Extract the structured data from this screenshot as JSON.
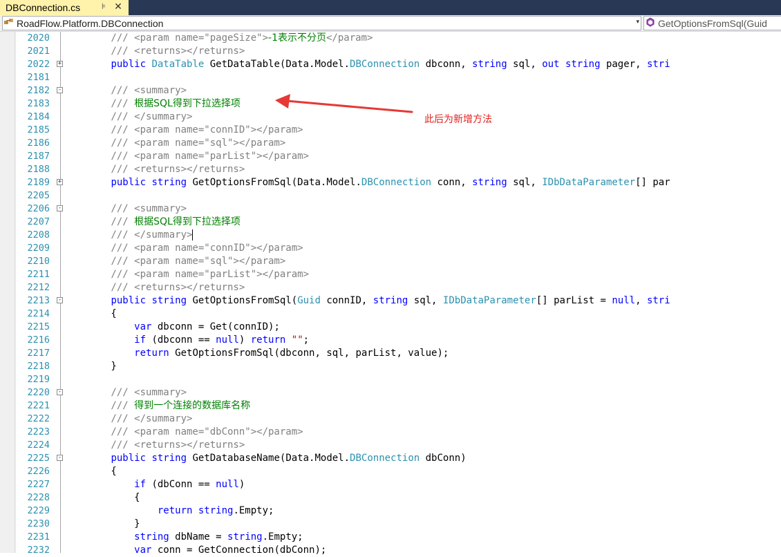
{
  "tab": {
    "title": "DBConnection.cs",
    "pin_glyph": "⊧",
    "close_glyph": "✕"
  },
  "navbar": {
    "left_path": "RoadFlow.Platform.DBConnection",
    "left_icon": "class-icon",
    "right_member": "GetOptionsFromSql(Guid",
    "right_icon": "method-icon",
    "dropdown_glyph": "▾"
  },
  "annotation": {
    "text": "此后为新增方法",
    "color": "#e0201e"
  },
  "colors": {
    "keyword": "#0000ff",
    "type": "#2b91af",
    "comment": "#808080",
    "xml_text": "#008000",
    "line_number": "#2b91af",
    "string": "#a31515"
  },
  "lines": [
    {
      "n": "2020",
      "fold": "",
      "tokens": [
        {
          "t": "        /// <param name=\"pageSize\">",
          "c": "cmt"
        },
        {
          "t": "-1表示不分页",
          "c": "green"
        },
        {
          "t": "</param>",
          "c": "cmt"
        }
      ]
    },
    {
      "n": "2021",
      "fold": "",
      "tokens": [
        {
          "t": "        /// <returns></returns>",
          "c": "cmt"
        }
      ]
    },
    {
      "n": "2022",
      "fold": "+",
      "tokens": [
        {
          "t": "        ",
          "c": ""
        },
        {
          "t": "public",
          "c": "kw"
        },
        {
          "t": " ",
          "c": ""
        },
        {
          "t": "DataTable",
          "c": "type"
        },
        {
          "t": " GetDataTable(Data.Model.",
          "c": ""
        },
        {
          "t": "DBConnection",
          "c": "type"
        },
        {
          "t": " dbconn, ",
          "c": ""
        },
        {
          "t": "string",
          "c": "kw"
        },
        {
          "t": " sql, ",
          "c": ""
        },
        {
          "t": "out",
          "c": "kw"
        },
        {
          "t": " ",
          "c": ""
        },
        {
          "t": "string",
          "c": "kw"
        },
        {
          "t": " pager, ",
          "c": ""
        },
        {
          "t": "stri",
          "c": "kw"
        }
      ]
    },
    {
      "n": "2181",
      "fold": "",
      "tokens": []
    },
    {
      "n": "2182",
      "fold": "-",
      "tokens": [
        {
          "t": "        /// <summary>",
          "c": "cmt"
        }
      ]
    },
    {
      "n": "2183",
      "fold": "",
      "tokens": [
        {
          "t": "        /// ",
          "c": "cmt"
        },
        {
          "t": "根据SQL得到下拉选择项",
          "c": "green"
        }
      ]
    },
    {
      "n": "2184",
      "fold": "",
      "tokens": [
        {
          "t": "        /// </summary>",
          "c": "cmt"
        }
      ]
    },
    {
      "n": "2185",
      "fold": "",
      "tokens": [
        {
          "t": "        /// <param name=\"connID\"></param>",
          "c": "cmt"
        }
      ]
    },
    {
      "n": "2186",
      "fold": "",
      "tokens": [
        {
          "t": "        /// <param name=\"sql\"></param>",
          "c": "cmt"
        }
      ]
    },
    {
      "n": "2187",
      "fold": "",
      "tokens": [
        {
          "t": "        /// <param name=\"parList\"></param>",
          "c": "cmt"
        }
      ]
    },
    {
      "n": "2188",
      "fold": "",
      "tokens": [
        {
          "t": "        /// <returns></returns>",
          "c": "cmt"
        }
      ]
    },
    {
      "n": "2189",
      "fold": "+",
      "tokens": [
        {
          "t": "        ",
          "c": ""
        },
        {
          "t": "public",
          "c": "kw"
        },
        {
          "t": " ",
          "c": ""
        },
        {
          "t": "string",
          "c": "kw"
        },
        {
          "t": " GetOptionsFromSql(Data.Model.",
          "c": ""
        },
        {
          "t": "DBConnection",
          "c": "type"
        },
        {
          "t": " conn, ",
          "c": ""
        },
        {
          "t": "string",
          "c": "kw"
        },
        {
          "t": " sql, ",
          "c": ""
        },
        {
          "t": "IDbDataParameter",
          "c": "type"
        },
        {
          "t": "[] par",
          "c": ""
        }
      ]
    },
    {
      "n": "2205",
      "fold": "",
      "tokens": []
    },
    {
      "n": "2206",
      "fold": "-",
      "tokens": [
        {
          "t": "        /// <summary>",
          "c": "cmt"
        }
      ]
    },
    {
      "n": "2207",
      "fold": "",
      "tokens": [
        {
          "t": "        /// ",
          "c": "cmt"
        },
        {
          "t": "根据SQL得到下拉选择项",
          "c": "green"
        }
      ]
    },
    {
      "n": "2208",
      "fold": "",
      "tokens": [
        {
          "t": "        /// </summary>",
          "c": "cmt"
        },
        {
          "t": "",
          "c": "caret"
        }
      ]
    },
    {
      "n": "2209",
      "fold": "",
      "tokens": [
        {
          "t": "        /// <param name=\"connID\"></param>",
          "c": "cmt"
        }
      ]
    },
    {
      "n": "2210",
      "fold": "",
      "tokens": [
        {
          "t": "        /// <param name=\"sql\"></param>",
          "c": "cmt"
        }
      ]
    },
    {
      "n": "2211",
      "fold": "",
      "tokens": [
        {
          "t": "        /// <param name=\"parList\"></param>",
          "c": "cmt"
        }
      ]
    },
    {
      "n": "2212",
      "fold": "",
      "tokens": [
        {
          "t": "        /// <returns></returns>",
          "c": "cmt"
        }
      ]
    },
    {
      "n": "2213",
      "fold": "-",
      "tokens": [
        {
          "t": "        ",
          "c": ""
        },
        {
          "t": "public",
          "c": "kw"
        },
        {
          "t": " ",
          "c": ""
        },
        {
          "t": "string",
          "c": "kw"
        },
        {
          "t": " GetOptionsFromSql(",
          "c": ""
        },
        {
          "t": "Guid",
          "c": "type"
        },
        {
          "t": " connID, ",
          "c": ""
        },
        {
          "t": "string",
          "c": "kw"
        },
        {
          "t": " sql, ",
          "c": ""
        },
        {
          "t": "IDbDataParameter",
          "c": "type"
        },
        {
          "t": "[] parList = ",
          "c": ""
        },
        {
          "t": "null",
          "c": "kw"
        },
        {
          "t": ", ",
          "c": ""
        },
        {
          "t": "stri",
          "c": "kw"
        }
      ]
    },
    {
      "n": "2214",
      "fold": "",
      "tokens": [
        {
          "t": "        {",
          "c": ""
        }
      ]
    },
    {
      "n": "2215",
      "fold": "",
      "tokens": [
        {
          "t": "            ",
          "c": ""
        },
        {
          "t": "var",
          "c": "kw"
        },
        {
          "t": " dbconn = Get(connID);",
          "c": ""
        }
      ]
    },
    {
      "n": "2216",
      "fold": "",
      "tokens": [
        {
          "t": "            ",
          "c": ""
        },
        {
          "t": "if",
          "c": "kw"
        },
        {
          "t": " (dbconn == ",
          "c": ""
        },
        {
          "t": "null",
          "c": "kw"
        },
        {
          "t": ") ",
          "c": ""
        },
        {
          "t": "return",
          "c": "kw"
        },
        {
          "t": " ",
          "c": ""
        },
        {
          "t": "\"\"",
          "c": "str"
        },
        {
          "t": ";",
          "c": ""
        }
      ]
    },
    {
      "n": "2217",
      "fold": "",
      "tokens": [
        {
          "t": "            ",
          "c": ""
        },
        {
          "t": "return",
          "c": "kw"
        },
        {
          "t": " GetOptionsFromSql(dbconn, sql, parList, value);",
          "c": ""
        }
      ]
    },
    {
      "n": "2218",
      "fold": "",
      "tokens": [
        {
          "t": "        }",
          "c": ""
        }
      ]
    },
    {
      "n": "2219",
      "fold": "",
      "tokens": []
    },
    {
      "n": "2220",
      "fold": "-",
      "tokens": [
        {
          "t": "        /// <summary>",
          "c": "cmt"
        }
      ]
    },
    {
      "n": "2221",
      "fold": "",
      "tokens": [
        {
          "t": "        /// ",
          "c": "cmt"
        },
        {
          "t": "得到一个连接的数据库名称",
          "c": "green"
        }
      ]
    },
    {
      "n": "2222",
      "fold": "",
      "tokens": [
        {
          "t": "        /// </summary>",
          "c": "cmt"
        }
      ]
    },
    {
      "n": "2223",
      "fold": "",
      "tokens": [
        {
          "t": "        /// <param name=\"dbConn\"></param>",
          "c": "cmt"
        }
      ]
    },
    {
      "n": "2224",
      "fold": "",
      "tokens": [
        {
          "t": "        /// <returns></returns>",
          "c": "cmt"
        }
      ]
    },
    {
      "n": "2225",
      "fold": "-",
      "tokens": [
        {
          "t": "        ",
          "c": ""
        },
        {
          "t": "public",
          "c": "kw"
        },
        {
          "t": " ",
          "c": ""
        },
        {
          "t": "string",
          "c": "kw"
        },
        {
          "t": " GetDatabaseName(Data.Model.",
          "c": ""
        },
        {
          "t": "DBConnection",
          "c": "type"
        },
        {
          "t": " dbConn)",
          "c": ""
        }
      ]
    },
    {
      "n": "2226",
      "fold": "",
      "tokens": [
        {
          "t": "        {",
          "c": ""
        }
      ]
    },
    {
      "n": "2227",
      "fold": "",
      "tokens": [
        {
          "t": "            ",
          "c": ""
        },
        {
          "t": "if",
          "c": "kw"
        },
        {
          "t": " (dbConn == ",
          "c": ""
        },
        {
          "t": "null",
          "c": "kw"
        },
        {
          "t": ")",
          "c": ""
        }
      ]
    },
    {
      "n": "2228",
      "fold": "",
      "tokens": [
        {
          "t": "            {",
          "c": ""
        }
      ]
    },
    {
      "n": "2229",
      "fold": "",
      "tokens": [
        {
          "t": "                ",
          "c": ""
        },
        {
          "t": "return",
          "c": "kw"
        },
        {
          "t": " ",
          "c": ""
        },
        {
          "t": "string",
          "c": "kw"
        },
        {
          "t": ".Empty;",
          "c": ""
        }
      ]
    },
    {
      "n": "2230",
      "fold": "",
      "tokens": [
        {
          "t": "            }",
          "c": ""
        }
      ]
    },
    {
      "n": "2231",
      "fold": "",
      "tokens": [
        {
          "t": "            ",
          "c": ""
        },
        {
          "t": "string",
          "c": "kw"
        },
        {
          "t": " dbName = ",
          "c": ""
        },
        {
          "t": "string",
          "c": "kw"
        },
        {
          "t": ".Empty;",
          "c": ""
        }
      ]
    },
    {
      "n": "2232",
      "fold": "",
      "tokens": [
        {
          "t": "            ",
          "c": ""
        },
        {
          "t": "var",
          "c": "kw"
        },
        {
          "t": " conn = GetConnection(dbConn);",
          "c": ""
        }
      ]
    }
  ]
}
